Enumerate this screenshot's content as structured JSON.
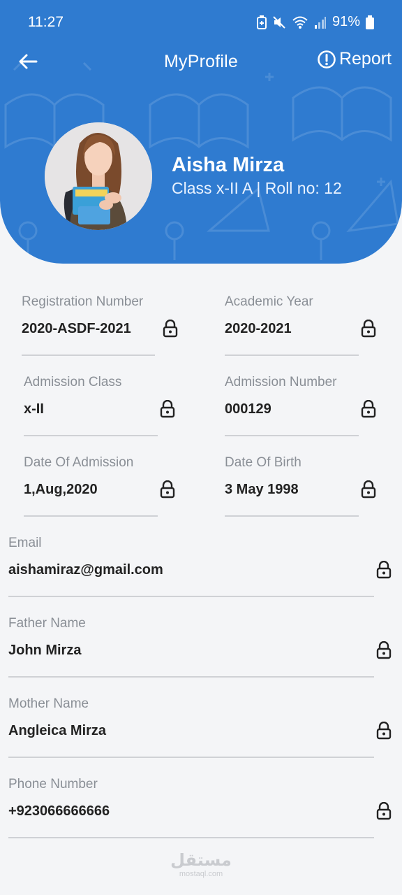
{
  "status_bar": {
    "time": "11:27",
    "battery": "91%",
    "icons": [
      "battery-saver-icon",
      "mute-icon",
      "wifi-icon",
      "signal-icon",
      "battery-icon"
    ]
  },
  "appbar": {
    "title": "MyProfile",
    "report_label": "Report"
  },
  "profile": {
    "name": "Aisha Mirza",
    "class_info": "Class x-II A | Roll no: 12"
  },
  "fields": {
    "registration_number": {
      "label": "Registration Number",
      "value": "2020-ASDF-2021"
    },
    "academic_year": {
      "label": "Academic Year",
      "value": "2020-2021"
    },
    "admission_class": {
      "label": "Admission Class",
      "value": "x-II"
    },
    "admission_number": {
      "label": "Admission Number",
      "value": "000129"
    },
    "date_of_admission": {
      "label": "Date Of Admission",
      "value": "1,Aug,2020"
    },
    "date_of_birth": {
      "label": "Date Of Birth",
      "value": "3 May 1998"
    },
    "email": {
      "label": "Email",
      "value": "aishamiraz@gmail.com"
    },
    "father_name": {
      "label": "Father Name",
      "value": "John Mirza"
    },
    "mother_name": {
      "label": "Mother Name",
      "value": "Angleica Mirza"
    },
    "phone_number": {
      "label": "Phone Number",
      "value": "+923066666666"
    }
  },
  "watermark": {
    "arabic": "مستقل",
    "latin": "mostaql.com"
  },
  "colors": {
    "primary": "#2f7bd0",
    "background": "#f4f5f7"
  }
}
